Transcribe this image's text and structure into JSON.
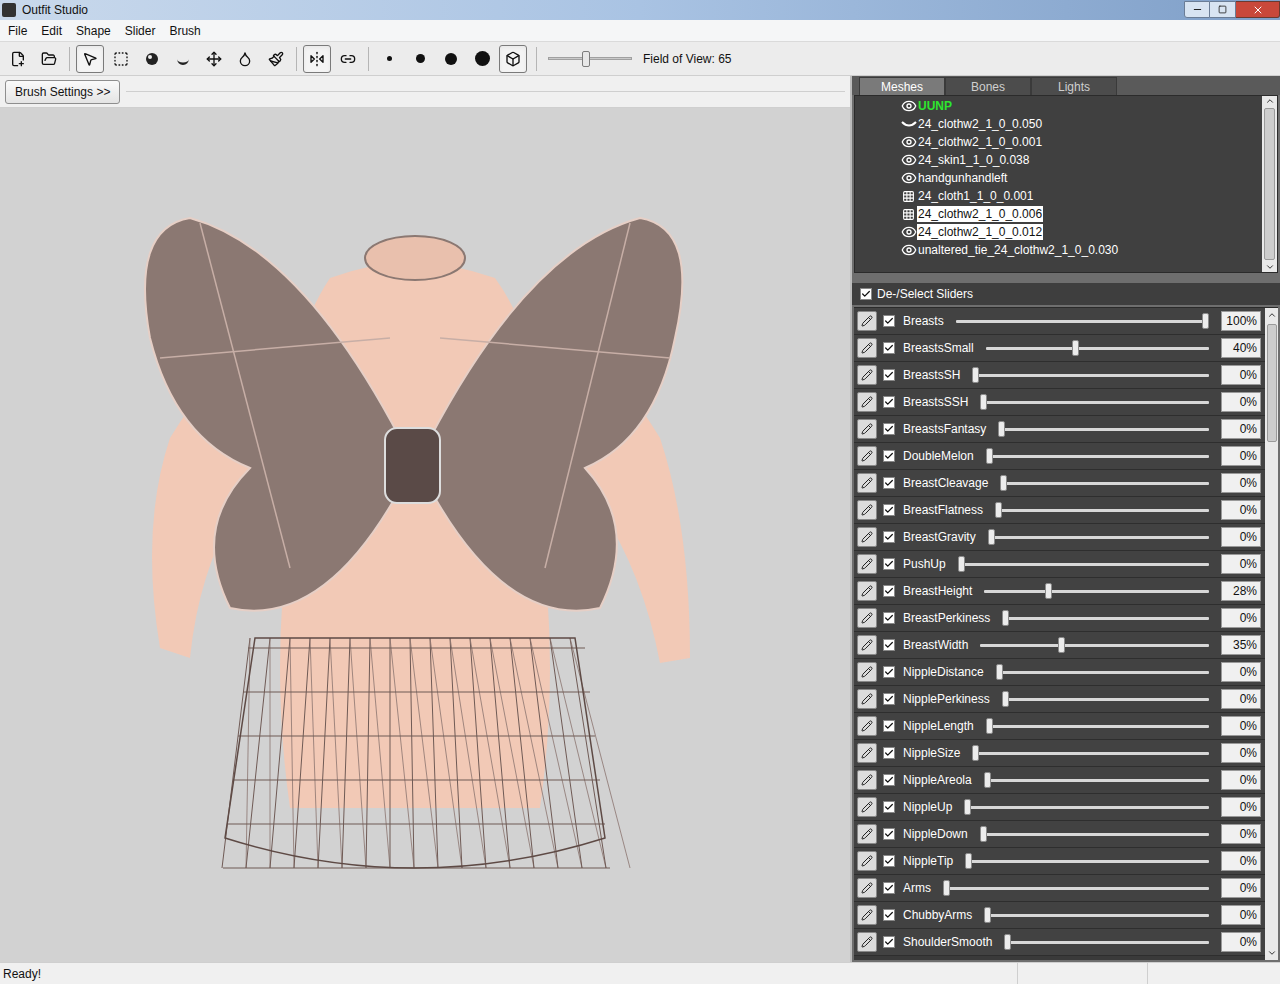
{
  "window": {
    "title": "Outfit Studio"
  },
  "menu": [
    "File",
    "Edit",
    "Shape",
    "Slider",
    "Brush"
  ],
  "toolbar": {
    "tools": [
      {
        "kind": "new-project",
        "selected": false
      },
      {
        "kind": "load-reference",
        "selected": false
      },
      {
        "kind": "select",
        "selected": true
      },
      {
        "kind": "mask",
        "selected": false
      },
      {
        "kind": "inflate",
        "selected": false
      },
      {
        "kind": "deflate",
        "selected": false
      },
      {
        "kind": "move",
        "selected": false
      },
      {
        "kind": "smooth",
        "selected": false
      },
      {
        "kind": "weight",
        "selected": false
      },
      {
        "kind": "mirror",
        "selected": true
      },
      {
        "kind": "connected",
        "selected": false
      },
      {
        "kind": "size-1",
        "selected": false
      },
      {
        "kind": "size-2",
        "selected": false
      },
      {
        "kind": "size-3",
        "selected": false
      },
      {
        "kind": "size-4",
        "selected": false
      },
      {
        "kind": "cube",
        "selected": true
      }
    ],
    "fov": {
      "level": 0.45,
      "label": "Field of View: 65"
    }
  },
  "brush_settings": {
    "label": "Brush Settings >>"
  },
  "tabs": [
    {
      "label": "Meshes",
      "selected": true
    },
    {
      "label": "Bones",
      "selected": false
    },
    {
      "label": "Lights",
      "selected": false
    }
  ],
  "meshes": [
    {
      "name": "UUNP",
      "kind": "shown",
      "reference": true,
      "selected": false
    },
    {
      "name": "24_clothw2_1_0_0.050",
      "kind": "hidden",
      "reference": false,
      "selected": false
    },
    {
      "name": "24_clothw2_1_0_0.001",
      "kind": "shown",
      "reference": false,
      "selected": false
    },
    {
      "name": "24_skin1_1_0_0.038",
      "kind": "shown",
      "reference": false,
      "selected": false
    },
    {
      "name": "handgunhandleft",
      "kind": "shown",
      "reference": false,
      "selected": false
    },
    {
      "name": "24_cloth1_1_0_0.001",
      "kind": "wireframe",
      "reference": false,
      "selected": false
    },
    {
      "name": "24_clothw2_1_0_0.006",
      "kind": "wireframe",
      "reference": false,
      "selected": true
    },
    {
      "name": "24_clothw2_1_0_0.012",
      "kind": "shown",
      "reference": false,
      "selected": true
    },
    {
      "name": "unaltered_tie_24_clothw2_1_0_0.030",
      "kind": "shown",
      "reference": false,
      "selected": false
    }
  ],
  "sliders_header": {
    "label": "De-/Select Sliders",
    "checked": true
  },
  "sliders": [
    {
      "name": "Breasts",
      "checked": true,
      "level": 1,
      "reading": "100%"
    },
    {
      "name": "BreastsSmall",
      "checked": true,
      "level": 0.4,
      "reading": "40%"
    },
    {
      "name": "BreastsSH",
      "checked": true,
      "level": 0,
      "reading": "0%"
    },
    {
      "name": "BreastsSSH",
      "checked": true,
      "level": 0,
      "reading": "0%"
    },
    {
      "name": "BreastsFantasy",
      "checked": true,
      "level": 0,
      "reading": "0%"
    },
    {
      "name": "DoubleMelon",
      "checked": true,
      "level": 0,
      "reading": "0%"
    },
    {
      "name": "BreastCleavage",
      "checked": true,
      "level": 0,
      "reading": "0%"
    },
    {
      "name": "BreastFlatness",
      "checked": true,
      "level": 0,
      "reading": "0%"
    },
    {
      "name": "BreastGravity",
      "checked": true,
      "level": 0,
      "reading": "0%"
    },
    {
      "name": "PushUp",
      "checked": true,
      "level": 0,
      "reading": "0%"
    },
    {
      "name": "BreastHeight",
      "checked": true,
      "level": 0.28,
      "reading": "28%"
    },
    {
      "name": "BreastPerkiness",
      "checked": true,
      "level": 0,
      "reading": "0%"
    },
    {
      "name": "BreastWidth",
      "checked": true,
      "level": 0.35,
      "reading": "35%"
    },
    {
      "name": "NippleDistance",
      "checked": true,
      "level": 0,
      "reading": "0%"
    },
    {
      "name": "NipplePerkiness",
      "checked": true,
      "level": 0,
      "reading": "0%"
    },
    {
      "name": "NippleLength",
      "checked": true,
      "level": 0,
      "reading": "0%"
    },
    {
      "name": "NippleSize",
      "checked": true,
      "level": 0,
      "reading": "0%"
    },
    {
      "name": "NippleAreola",
      "checked": true,
      "level": 0,
      "reading": "0%"
    },
    {
      "name": "NippleUp",
      "checked": true,
      "level": 0,
      "reading": "0%"
    },
    {
      "name": "NippleDown",
      "checked": true,
      "level": 0,
      "reading": "0%"
    },
    {
      "name": "NippleTip",
      "checked": true,
      "level": 0,
      "reading": "0%"
    },
    {
      "name": "Arms",
      "checked": true,
      "level": 0,
      "reading": "0%"
    },
    {
      "name": "ChubbyArms",
      "checked": true,
      "level": 0,
      "reading": "0%"
    },
    {
      "name": "ShoulderSmooth",
      "checked": true,
      "level": 0,
      "reading": "0%"
    }
  ],
  "status_bar": "Ready!"
}
